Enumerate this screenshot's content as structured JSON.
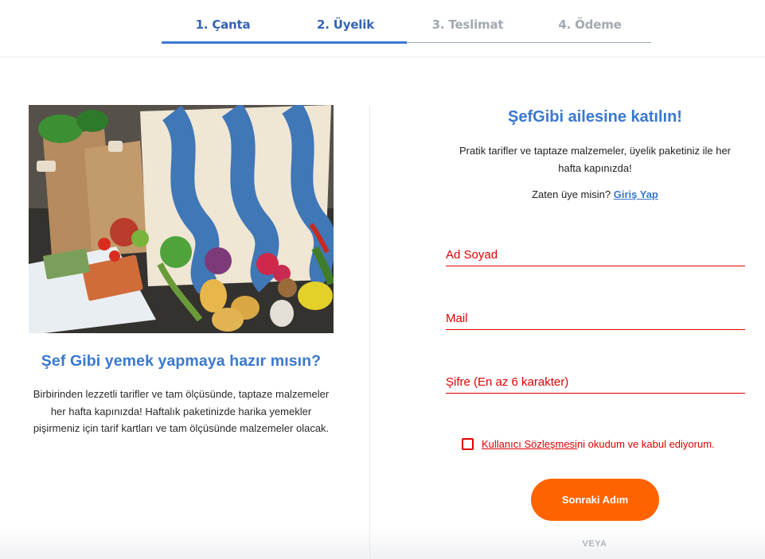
{
  "stepper": {
    "steps": [
      {
        "label": "1. Çanta",
        "state": "done"
      },
      {
        "label": "2. Üyelik",
        "state": "active"
      },
      {
        "label": "3. Teslimat",
        "state": "todo"
      },
      {
        "label": "4. Ödeme",
        "state": "todo"
      }
    ]
  },
  "left": {
    "image_icon": "groceries-photo",
    "title": "Şef Gibi yemek yapmaya hazır mısın?",
    "description": "Birbirinden lezzetli tarifler ve tam ölçüsünde, taptaze malzemeler her hafta kapınızda! Haftalık paketinizde harika yemekler pişirmeniz için tarif kartları ve tam ölçüsünde malzemeler olacak."
  },
  "right": {
    "title": "ŞefGibi ailesine katılın!",
    "subtitle": "Pratik tarifler ve taptaze malzemeler, üyelik paketiniz ile her hafta kapınızda!",
    "login_prompt": "Zaten üye misin?",
    "login_link": "Giriş Yap",
    "fields": {
      "name": {
        "placeholder": "Ad Soyad",
        "value": ""
      },
      "mail": {
        "placeholder": "Mail",
        "value": ""
      },
      "password": {
        "placeholder": "Şifre (En az 6 karakter)",
        "value": ""
      }
    },
    "agreement": {
      "checked": false,
      "link_text": "Kullanıcı Sözleşmesi",
      "rest_text": "ni okudum ve kabul ediyorum."
    },
    "next_button": "Sonraki Adım",
    "or_text": "VEYA"
  },
  "colors": {
    "brand_blue": "#3a78cf",
    "step_bar": "#3b78d4",
    "error_red": "#e00000",
    "cta_orange": "#ff6300",
    "muted": "#a3a9b1"
  }
}
